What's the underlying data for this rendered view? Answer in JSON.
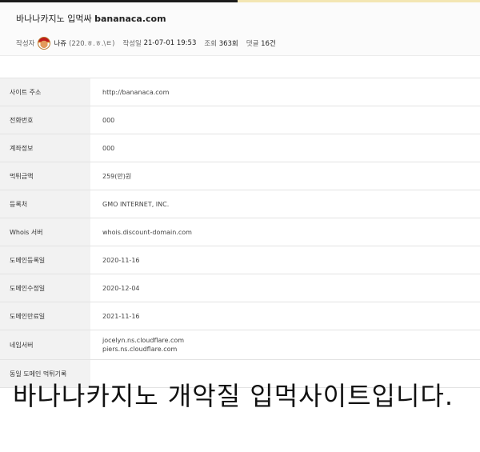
{
  "header": {
    "title": "바나나카지노 입먹싸",
    "title_domain": "bananaca.com",
    "meta": {
      "author_label": "작성자",
      "author_name": "나쥬",
      "author_ip": "(220.ㅎ.ㅎ.\\ㅌ)",
      "date_label": "작성일",
      "date_value": "21-07-01 19:53",
      "views_label": "조회",
      "views_value": "363회",
      "comments_label": "댓글",
      "comments_value": "16건"
    }
  },
  "table": {
    "rows": [
      {
        "label": "사이트 주소",
        "value": "http://bananaca.com"
      },
      {
        "label": "전화번호",
        "value": "000"
      },
      {
        "label": "계좌정보",
        "value": "000"
      },
      {
        "label": "먹튀금액",
        "value": "259(만)원"
      },
      {
        "label": "등록처",
        "value": "GMO INTERNET, INC."
      },
      {
        "label": "Whois 서버",
        "value": "whois.discount-domain.com"
      },
      {
        "label": "도메인등록일",
        "value": "2020-11-16"
      },
      {
        "label": "도메인수정일",
        "value": "2020-12-04"
      },
      {
        "label": "도메인만료일",
        "value": "2021-11-16"
      },
      {
        "label": "네임서버",
        "value_lines": [
          "jocelyn.ns.cloudflare.com",
          "piers.ns.cloudflare.com"
        ]
      },
      {
        "label": "동일 도메인 먹튀기록",
        "value": ""
      }
    ]
  },
  "body_text": "바나나카지노 개악질 입먹사이트입니다."
}
